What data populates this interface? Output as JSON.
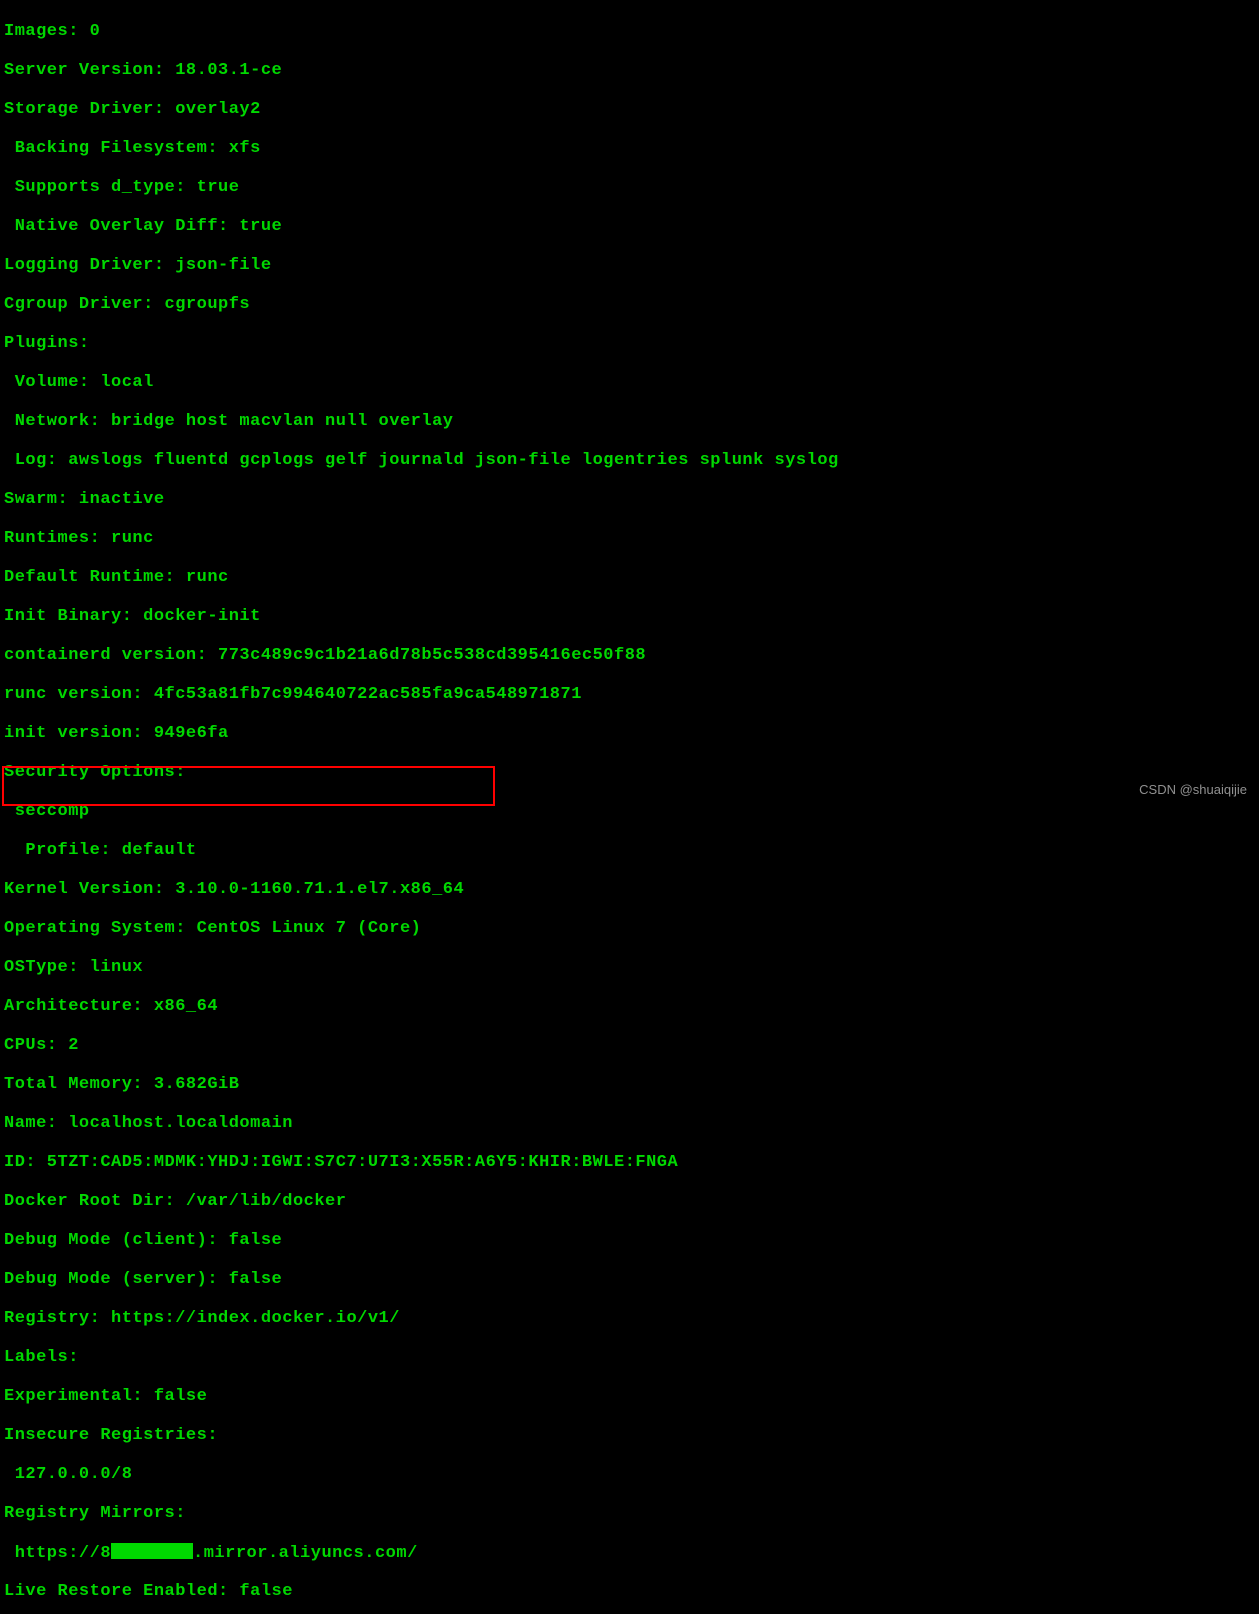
{
  "terminal": {
    "lines": [
      "Images: 0",
      "Server Version: 18.03.1-ce",
      "Storage Driver: overlay2",
      " Backing Filesystem: xfs",
      " Supports d_type: true",
      " Native Overlay Diff: true",
      "Logging Driver: json-file",
      "Cgroup Driver: cgroupfs",
      "Plugins:",
      " Volume: local",
      " Network: bridge host macvlan null overlay",
      " Log: awslogs fluentd gcplogs gelf journald json-file logentries splunk syslog",
      "Swarm: inactive",
      "Runtimes: runc",
      "Default Runtime: runc",
      "Init Binary: docker-init",
      "containerd version: 773c489c9c1b21a6d78b5c538cd395416ec50f88",
      "runc version: 4fc53a81fb7c994640722ac585fa9ca548971871",
      "init version: 949e6fa",
      "Security Options:",
      " seccomp",
      "  Profile: default",
      "Kernel Version: 3.10.0-1160.71.1.el7.x86_64",
      "Operating System: CentOS Linux 7 (Core)",
      "OSType: linux",
      "Architecture: x86_64",
      "CPUs: 2",
      "Total Memory: 3.682GiB",
      "Name: localhost.localdomain",
      "ID: 5TZT:CAD5:MDMK:YHDJ:IGWI:S7C7:U7I3:X55R:A6Y5:KHIR:BWLE:FNGA",
      "Docker Root Dir: /var/lib/docker",
      "Debug Mode (client): false",
      "Debug Mode (server): false",
      "Registry: https://index.docker.io/v1/",
      "Labels:",
      "Experimental: false",
      "Insecure Registries:",
      " 127.0.0.0/8",
      "Registry Mirrors:"
    ],
    "mirror_prefix": " https://8",
    "mirror_suffix": ".mirror.aliyuncs.com/",
    "last_line": "Live Restore Enabled: false"
  },
  "watermark": "CSDN @shuaiqijie"
}
